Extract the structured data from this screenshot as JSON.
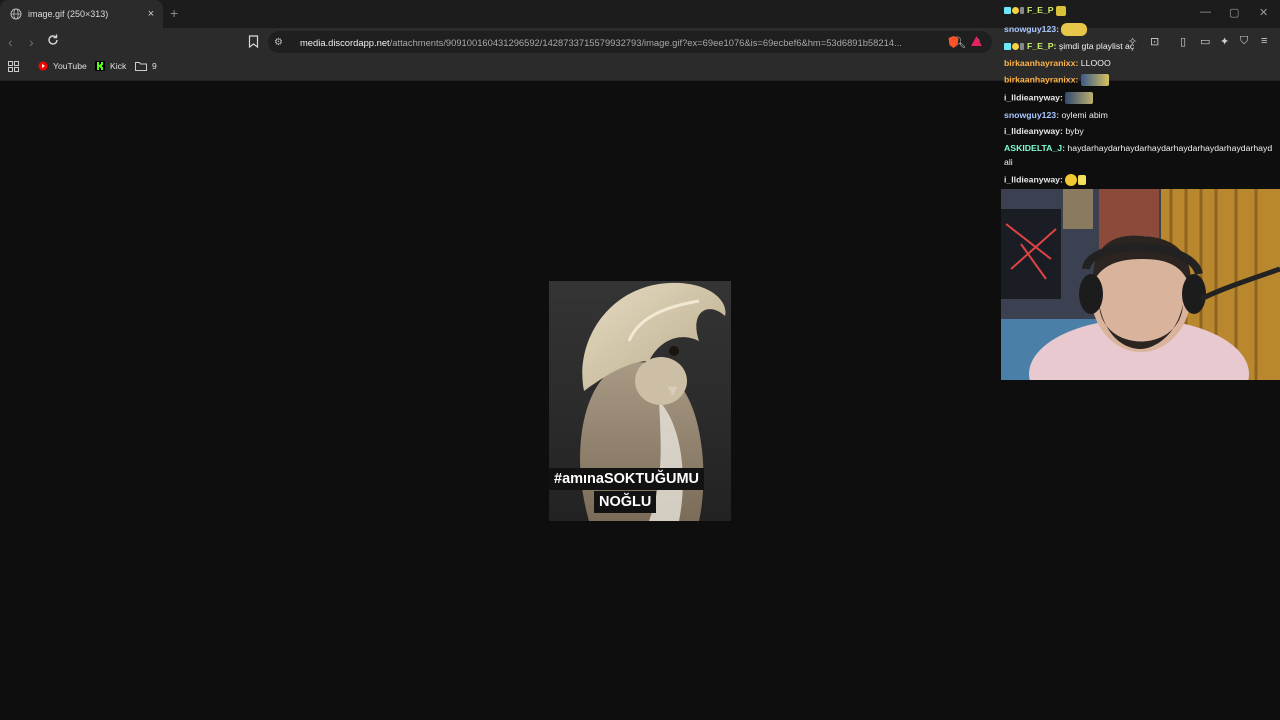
{
  "tab": {
    "title": "image.gif (250×313)",
    "close": "×",
    "new_tab": "+"
  },
  "window_controls": {
    "minimize": "—",
    "maximize": "▢",
    "close": "✕"
  },
  "address_bar": {
    "host": "media.discordapp.net",
    "path": "/attachments/909100160431296592/1428733715579932793/image.gif?ex=69ee1076&is=69ecbef6&hm=53d6891b58214..."
  },
  "bookmarks": [
    {
      "label": "YouTube",
      "icon": "youtube-icon",
      "color": "#ff0000"
    },
    {
      "label": "Kick",
      "icon": "kick-icon",
      "color": "#53fc18"
    },
    {
      "label": "9",
      "icon": "folder-icon"
    }
  ],
  "image": {
    "caption_line1": "#amınaSOKTUĞUMU",
    "caption_line2": "NOĞLU"
  },
  "chat": {
    "messages": [
      {
        "user": "F_E_P",
        "text": "",
        "color": "#c9f06a",
        "badges": true,
        "emote": true
      },
      {
        "user": "snowguy123:",
        "text": "",
        "color": "#a9c8ff",
        "emote": true
      },
      {
        "user": "F_E_P:",
        "text": "şimdi gta playlist aç",
        "color": "#c9f06a",
        "badges": true
      },
      {
        "user": "birkaanhayranixx:",
        "text": "LLOOO",
        "color": "#ffb347"
      },
      {
        "user": "birkaanhayranixx:",
        "text": "",
        "color": "#ffb347",
        "emote": true
      },
      {
        "user": "i_lldieanyway:",
        "text": "",
        "color": "#e8e8e8",
        "emote": true
      },
      {
        "user": "snowguy123:",
        "text": "oylemi abim",
        "color": "#a9c8ff"
      },
      {
        "user": "i_lldieanyway:",
        "text": "byby",
        "color": "#e8e8e8"
      },
      {
        "user": "ASKIDELTA_J:",
        "text": "haydarhaydarhaydarhaydarhaydarhaydarhaydarhayd",
        "color": "#7fffd4"
      },
      {
        "user": "",
        "text": "ali",
        "color": "#e8e8e8"
      },
      {
        "user": "i_lldieanyway:",
        "text": "",
        "color": "#e8e8e8",
        "emote": true
      }
    ]
  },
  "colors": {
    "accent_brave": "#fb542b",
    "page_bg": "#0e0e0e",
    "chrome_bg": "#2b2b2b"
  }
}
